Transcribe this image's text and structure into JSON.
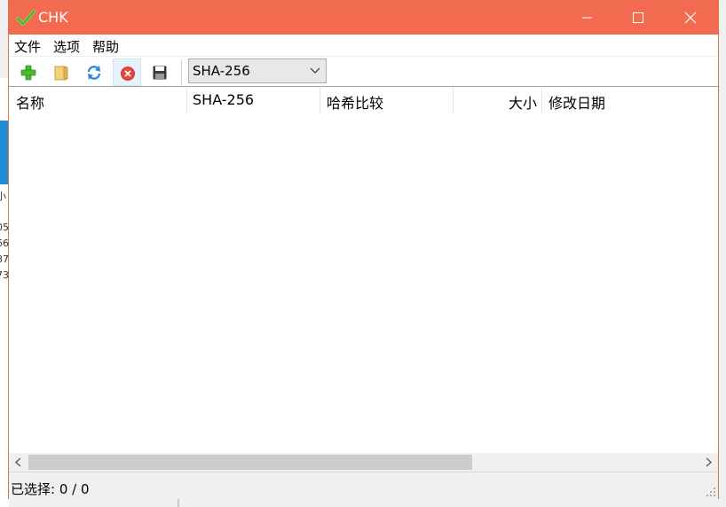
{
  "window": {
    "title": "CHK",
    "accent_color": "#f26b50",
    "controls": [
      "minimize-icon",
      "maximize-icon",
      "close-icon"
    ]
  },
  "menu": {
    "items": [
      {
        "label": "文件"
      },
      {
        "label": "选项"
      },
      {
        "label": "帮助"
      }
    ]
  },
  "toolbar": {
    "buttons": [
      {
        "name": "add",
        "icon": "plus-icon"
      },
      {
        "name": "open",
        "icon": "folder-icon"
      },
      {
        "name": "refresh",
        "icon": "refresh-icon"
      },
      {
        "name": "stop",
        "icon": "stop-icon"
      },
      {
        "name": "save",
        "icon": "save-icon"
      }
    ],
    "algorithm": {
      "selected": "SHA-256"
    }
  },
  "list": {
    "columns": [
      {
        "label": "名称"
      },
      {
        "label": "SHA-256"
      },
      {
        "label": "哈希比较"
      },
      {
        "label": "大小"
      },
      {
        "label": "修改日期"
      }
    ],
    "rows": []
  },
  "status": {
    "text": "已选择: 0 / 0"
  },
  "background_window": {
    "fragments": [
      "小",
      "05",
      "66",
      "87",
      "73"
    ]
  }
}
